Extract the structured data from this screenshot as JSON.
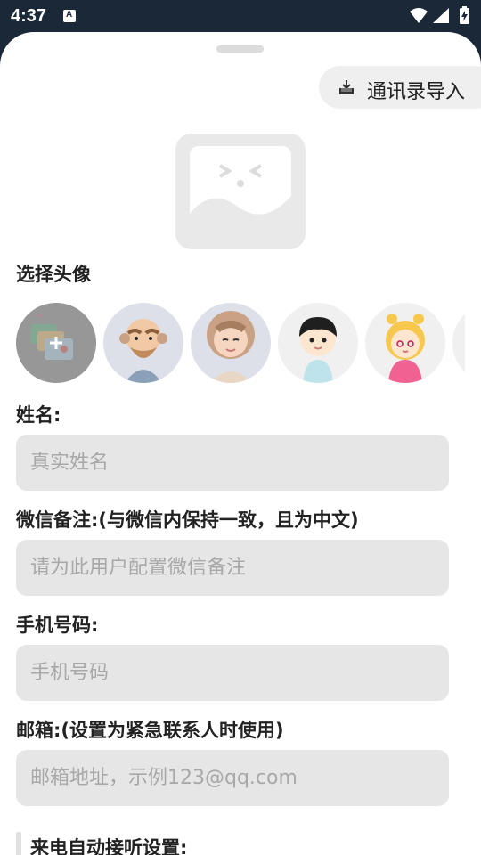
{
  "status_bar": {
    "time": "4:37",
    "notification_icon": "A",
    "icons": [
      "wifi-icon",
      "signal-icon",
      "battery-icon"
    ]
  },
  "import_button": {
    "label": "通讯录导入",
    "icon": "download-icon"
  },
  "avatar_section": {
    "label": "选择头像",
    "avatars": [
      {
        "name": "custom-photo-avatar",
        "selected": true
      },
      {
        "name": "bald-old-man-avatar"
      },
      {
        "name": "old-woman-avatar"
      },
      {
        "name": "boy-avatar"
      },
      {
        "name": "girl-avatar"
      },
      {
        "name": "partial-avatar"
      }
    ]
  },
  "form": {
    "name": {
      "label": "姓名:",
      "placeholder": "真实姓名",
      "value": ""
    },
    "wechat": {
      "label": "微信备注:(与微信内保持一致，且为中文)",
      "placeholder": "请为此用户配置微信备注",
      "value": ""
    },
    "phone": {
      "label": "手机号码:",
      "placeholder": "手机号码",
      "value": ""
    },
    "email": {
      "label": "邮箱:(设置为紧急联系人时使用)",
      "placeholder": "邮箱地址，示例123@qq.com",
      "value": ""
    },
    "auto_answer": {
      "label": "来电自动接听设置:"
    }
  },
  "colors": {
    "background_dark": "#1b2838",
    "field_bg": "#e6e6e6",
    "placeholder": "#a8a8a8"
  }
}
